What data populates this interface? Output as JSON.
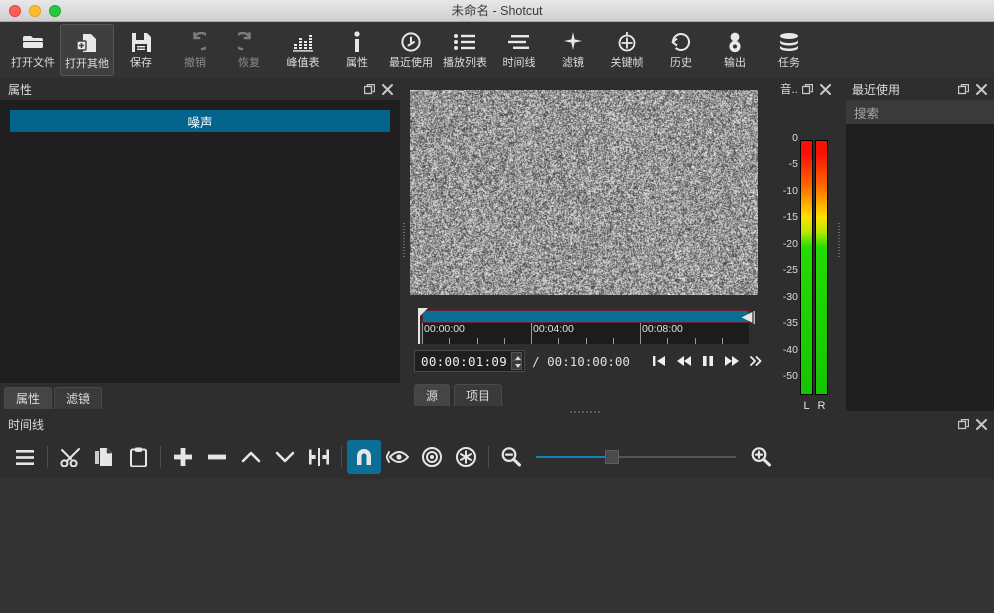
{
  "window": {
    "title": "未命名 - Shotcut",
    "traffic_lights": [
      "close",
      "minimize",
      "zoom"
    ]
  },
  "toolbar": {
    "items": [
      {
        "label": "打开文件",
        "icon": "open-file-icon",
        "state": "normal"
      },
      {
        "label": "打开其他",
        "icon": "open-other-icon",
        "state": "active"
      },
      {
        "label": "保存",
        "icon": "save-icon",
        "state": "normal"
      },
      {
        "label": "撤销",
        "icon": "undo-icon",
        "state": "disabled"
      },
      {
        "label": "恢复",
        "icon": "redo-icon",
        "state": "disabled"
      },
      {
        "label": "峰值表",
        "icon": "audio-peak-meter-icon",
        "state": "normal"
      },
      {
        "label": "属性",
        "icon": "properties-info-icon",
        "state": "normal"
      },
      {
        "label": "最近使用",
        "icon": "recent-clock-icon",
        "state": "normal"
      },
      {
        "label": "播放列表",
        "icon": "playlist-icon",
        "state": "normal"
      },
      {
        "label": "时间线",
        "icon": "timeline-icon",
        "state": "normal"
      },
      {
        "label": "滤镜",
        "icon": "filters-sparkle-icon",
        "state": "normal"
      },
      {
        "label": "关键帧",
        "icon": "keyframes-icon",
        "state": "normal"
      },
      {
        "label": "历史",
        "icon": "history-icon",
        "state": "normal"
      },
      {
        "label": "输出",
        "icon": "export-icon",
        "state": "normal"
      },
      {
        "label": "任务",
        "icon": "jobs-stack-icon",
        "state": "normal"
      }
    ]
  },
  "properties_panel": {
    "title": "属性",
    "chip_label": "噪声",
    "chip_color": "#05648c",
    "tabs": [
      {
        "label": "属性",
        "selected": true
      },
      {
        "label": "滤镜",
        "selected": false
      }
    ],
    "float_button": "float-icon",
    "close_button": "close-icon"
  },
  "player": {
    "video_content": "grayscale-static-noise",
    "scrub": {
      "fill_color": "#0b6e94",
      "border_color": "#6b2230",
      "ruler_labels": [
        "00:00:00",
        "00:04:00",
        "00:08:00"
      ],
      "playhead_position_percent": 0
    },
    "current_timecode": "00:00:01:09",
    "separator": "/",
    "total_timecode": "00:10:00:00",
    "transport_buttons": [
      {
        "name": "skip-to-start-button",
        "glyph": "skip-start"
      },
      {
        "name": "rewind-button",
        "glyph": "rewind"
      },
      {
        "name": "pause-button",
        "glyph": "pause"
      },
      {
        "name": "fast-forward-button",
        "glyph": "fast-forward"
      },
      {
        "name": "skip-next-button",
        "glyph": "skip-next"
      }
    ],
    "tabs": [
      {
        "label": "源",
        "selected": true
      },
      {
        "label": "项目",
        "selected": false
      }
    ]
  },
  "audio_meter": {
    "title": "音...",
    "scale_labels": [
      "0",
      "-5",
      "-10",
      "-15",
      "-20",
      "-25",
      "-30",
      "-35",
      "-40",
      "-50"
    ],
    "channel_labels": [
      "L",
      "R"
    ]
  },
  "recent_panel": {
    "title": "最近使用",
    "search_placeholder": "搜索",
    "items": []
  },
  "timeline_panel": {
    "title": "时间线",
    "buttons": [
      {
        "name": "timeline-menu-button",
        "icon": "hamburger-menu-icon",
        "active": false
      },
      {
        "name": "cut-button",
        "icon": "scissors-icon",
        "active": false
      },
      {
        "name": "copy-button",
        "icon": "copy-icon",
        "active": false
      },
      {
        "name": "paste-button",
        "icon": "paste-clipboard-icon",
        "active": false
      },
      {
        "name": "append-button",
        "icon": "plus-icon",
        "active": false
      },
      {
        "name": "ripple-delete-button",
        "icon": "minus-icon",
        "active": false
      },
      {
        "name": "lift-button",
        "icon": "chevron-up-icon",
        "active": false
      },
      {
        "name": "overwrite-button",
        "icon": "chevron-down-icon",
        "active": false
      },
      {
        "name": "split-button",
        "icon": "split-icon",
        "active": false
      },
      {
        "name": "snap-button",
        "icon": "magnet-icon",
        "active": true
      },
      {
        "name": "scrub-while-dragging-button",
        "icon": "eye-icon",
        "active": false
      },
      {
        "name": "ripple-button",
        "icon": "target-circle-icon",
        "active": false
      },
      {
        "name": "ripple-all-tracks-button",
        "icon": "asterisk-circle-icon",
        "active": false
      },
      {
        "name": "zoom-timeline-out-button",
        "icon": "zoom-out-icon",
        "active": false
      },
      {
        "name": "zoom-timeline-in-button",
        "icon": "zoom-in-icon",
        "active": false
      }
    ],
    "zoom_slider_value_percent": 37,
    "tracks": []
  }
}
